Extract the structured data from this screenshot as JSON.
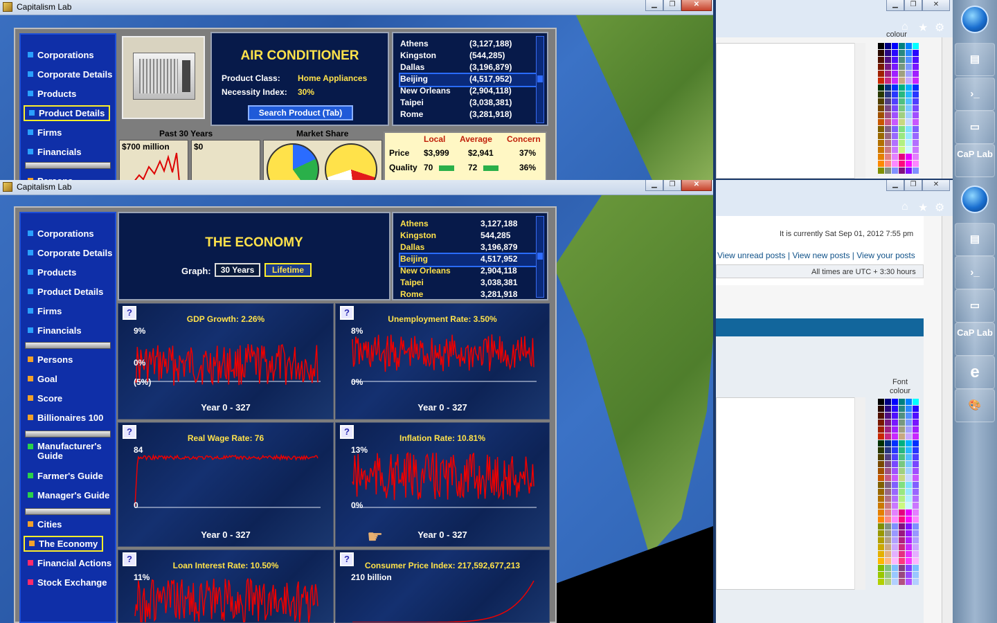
{
  "window_top": {
    "title": "Capitalism Lab"
  },
  "window_bottom": {
    "title": "Capitalism Lab"
  },
  "nav_top": [
    {
      "label": "Corporations",
      "color": "#2aa0ff"
    },
    {
      "label": "Corporate Details",
      "color": "#2aa0ff"
    },
    {
      "label": "Products",
      "color": "#2aa0ff"
    },
    {
      "label": "Product Details",
      "color": "#2aa0ff",
      "selected": true
    },
    {
      "label": "Firms",
      "color": "#2aa0ff"
    },
    {
      "label": "Financials",
      "color": "#2aa0ff"
    },
    {
      "label": "Persons",
      "color": "#f2a22a"
    }
  ],
  "nav_bottom": [
    {
      "label": "Corporations",
      "color": "#2aa0ff"
    },
    {
      "label": "Corporate Details",
      "color": "#2aa0ff"
    },
    {
      "label": "Products",
      "color": "#2aa0ff"
    },
    {
      "label": "Product Details",
      "color": "#2aa0ff"
    },
    {
      "label": "Firms",
      "color": "#2aa0ff"
    },
    {
      "label": "Financials",
      "color": "#2aa0ff"
    },
    {
      "label": "Persons",
      "color": "#f2a22a"
    },
    {
      "label": "Goal",
      "color": "#f2a22a"
    },
    {
      "label": "Score",
      "color": "#f2a22a"
    },
    {
      "label": "Billionaires 100",
      "color": "#f2a22a"
    },
    {
      "label": "Manufacturer's Guide",
      "color": "#2ad24a"
    },
    {
      "label": "Farmer's Guide",
      "color": "#2ad24a"
    },
    {
      "label": "Manager's Guide",
      "color": "#2ad24a"
    },
    {
      "label": "Cities",
      "color": "#f2a22a"
    },
    {
      "label": "The Economy",
      "color": "#f2a22a",
      "selected": true
    },
    {
      "label": "Financial Actions",
      "color": "#ff2a6a"
    },
    {
      "label": "Stock Exchange",
      "color": "#ff2a6a"
    }
  ],
  "product": {
    "name": "AIR CONDITIONER",
    "class_label": "Product Class:",
    "class_value": "Home Appliances",
    "necessity_label": "Necessity Index:",
    "necessity_value": "30%",
    "search_button": "Search Product (Tab)",
    "past_label": "Past 30 Years",
    "market_share_label": "Market Share",
    "sales_value": "$700 million",
    "profit_value": "$0"
  },
  "comparison": {
    "headers": [
      "Local",
      "Average",
      "Concern"
    ],
    "rows": [
      {
        "label": "Price",
        "local": "$3,999",
        "average": "$2,941",
        "concern": "37%"
      },
      {
        "label": "Quality",
        "local": "70",
        "average": "72",
        "concern": "36%"
      }
    ]
  },
  "cities_top": [
    {
      "name": "Athens",
      "pop": "(3,127,188)"
    },
    {
      "name": "Kingston",
      "pop": "(544,285)"
    },
    {
      "name": "Dallas",
      "pop": "(3,196,879)"
    },
    {
      "name": "Beijing",
      "pop": "(4,517,952)",
      "highlight": true
    },
    {
      "name": "New Orleans",
      "pop": "(2,904,118)"
    },
    {
      "name": "Taipei",
      "pop": "(3,038,381)"
    },
    {
      "name": "Rome",
      "pop": "(3,281,918)"
    }
  ],
  "cities_bottom": [
    {
      "name": "Athens",
      "pop": "3,127,188"
    },
    {
      "name": "Kingston",
      "pop": "544,285"
    },
    {
      "name": "Dallas",
      "pop": "3,196,879"
    },
    {
      "name": "Beijing",
      "pop": "4,517,952",
      "highlight": true
    },
    {
      "name": "New Orleans",
      "pop": "2,904,118"
    },
    {
      "name": "Taipei",
      "pop": "3,038,381"
    },
    {
      "name": "Rome",
      "pop": "3,281,918"
    }
  ],
  "economy": {
    "title": "THE ECONOMY",
    "graph_label": "Graph:",
    "graph_options": [
      "30 Years",
      "Lifetime"
    ],
    "selected_option": "Lifetime"
  },
  "charts": [
    {
      "title": "GDP Growth: 2.26%",
      "y_top": "9%",
      "y_mid": "0%",
      "y_bottom": "(5%)",
      "x_range": "Year 0 - 327"
    },
    {
      "title": "Unemployment Rate: 3.50%",
      "y_top": "8%",
      "y_mid": "",
      "y_bottom": "0%",
      "x_range": "Year 0 - 327"
    },
    {
      "title": "Real Wage Rate: 76",
      "y_top": "84",
      "y_mid": "",
      "y_bottom": "0",
      "x_range": "Year 0 - 327"
    },
    {
      "title": "Inflation Rate: 10.81%",
      "y_top": "13%",
      "y_mid": "",
      "y_bottom": "0%",
      "x_range": "Year 0 - 327"
    },
    {
      "title": "Loan Interest Rate: 10.50%",
      "y_top": "11%",
      "y_mid": "",
      "y_bottom": "",
      "x_range": ""
    },
    {
      "title": "Consumer Price Index: 217,592,677,213",
      "y_top": "210 billion",
      "y_mid": "",
      "y_bottom": "",
      "x_range": ""
    }
  ],
  "browser": {
    "current_time": "It is currently Sat Sep 01, 2012 7:55 pm",
    "links": [
      "View unread posts",
      "View new posts",
      "View your posts"
    ],
    "timezone": "All times are UTC + 3:30 hours",
    "font_colour_label": "Font colour",
    "colour_label_top": "colour"
  },
  "taskbar": {
    "caplab_label": "CaP Lab",
    "items": [
      "start-orb",
      "system-icon",
      "powershell-icon",
      "folder-icon",
      "caplab-icon",
      "ie-icon",
      "paint-icon"
    ]
  }
}
